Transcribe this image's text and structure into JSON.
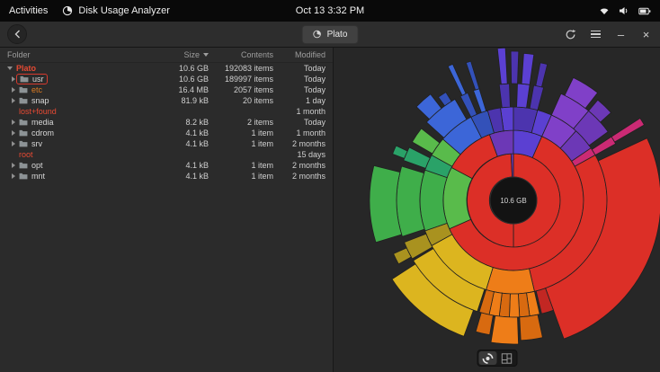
{
  "topbar": {
    "activities_label": "Activities",
    "app_menu_label": "Disk Usage Analyzer",
    "clock": "Oct 13  3:32 PM"
  },
  "headerbar": {
    "location_label": "Plato",
    "minimize_glyph": "–",
    "close_glyph": "×"
  },
  "table": {
    "columns": [
      "Folder",
      "Size",
      "Contents",
      "Modified"
    ],
    "rows": [
      {
        "name": "Plato",
        "size": "10.6 GB",
        "contents": "192083 items",
        "modified": "Today"
      },
      {
        "name": "usr",
        "size": "10.6 GB",
        "contents": "189997 items",
        "modified": "Today"
      },
      {
        "name": "etc",
        "size": "16.4 MB",
        "contents": "2057 items",
        "modified": "Today"
      },
      {
        "name": "snap",
        "size": "81.9 kB",
        "contents": "20 items",
        "modified": "1 day"
      },
      {
        "name": "lost+found",
        "size": "",
        "contents": "",
        "modified": "1 month"
      },
      {
        "name": "media",
        "size": "8.2 kB",
        "contents": "2 items",
        "modified": "Today"
      },
      {
        "name": "cdrom",
        "size": "4.1 kB",
        "contents": "1 item",
        "modified": "1 month"
      },
      {
        "name": "srv",
        "size": "4.1 kB",
        "contents": "1 item",
        "modified": "2 months"
      },
      {
        "name": "root",
        "size": "",
        "contents": "",
        "modified": "15 days"
      },
      {
        "name": "opt",
        "size": "4.1 kB",
        "contents": "1 item",
        "modified": "2 months"
      },
      {
        "name": "mnt",
        "size": "4.1 kB",
        "contents": "1 item",
        "modified": "2 months"
      }
    ]
  },
  "chart": {
    "center_label": "10.6 GB",
    "colors": {
      "red": "#dc2f27",
      "red2": "#c22723",
      "orange": "#ee7d18",
      "orange2": "#d86a10",
      "yellow": "#dcb51f",
      "olive": "#a9921f",
      "green": "#3fae4a",
      "green2": "#59bb4b",
      "teal": "#2aa268",
      "blue": "#3c66d8",
      "blue2": "#3351b9",
      "purple": "#8040c8",
      "purple2": "#6c38b6",
      "violet": "#5b40d2",
      "violet2": "#4c34ae",
      "magenta": "#cb2a74"
    },
    "segments": [
      [
        26,
        52,
        0,
        180,
        "red"
      ],
      [
        26,
        52,
        180,
        357,
        "red"
      ],
      [
        26,
        52,
        357,
        360,
        "purple2"
      ],
      [
        52,
        78,
        340,
        360,
        "purple2"
      ],
      [
        52,
        78,
        0,
        24,
        "violet"
      ],
      [
        52,
        78,
        24,
        246,
        "red"
      ],
      [
        52,
        78,
        246,
        298,
        "green2"
      ],
      [
        52,
        78,
        298,
        340,
        "red"
      ],
      [
        78,
        104,
        352,
        360,
        "violet"
      ],
      [
        78,
        104,
        0,
        15,
        "violet2"
      ],
      [
        78,
        104,
        15,
        24,
        "violet"
      ],
      [
        78,
        104,
        24,
        42,
        "purple"
      ],
      [
        78,
        104,
        42,
        56,
        "purple2"
      ],
      [
        78,
        104,
        56,
        61,
        "magenta"
      ],
      [
        78,
        104,
        61,
        167,
        "red"
      ],
      [
        78,
        104,
        167,
        197,
        "orange"
      ],
      [
        78,
        104,
        197,
        241,
        "yellow"
      ],
      [
        78,
        104,
        241,
        251,
        "olive"
      ],
      [
        78,
        104,
        251,
        289,
        "green"
      ],
      [
        78,
        104,
        289,
        299,
        "teal"
      ],
      [
        78,
        104,
        299,
        311,
        "green2"
      ],
      [
        78,
        104,
        311,
        333,
        "blue"
      ],
      [
        78,
        104,
        333,
        344,
        "blue2"
      ],
      [
        78,
        104,
        344,
        352,
        "violet2"
      ],
      [
        104,
        130,
        353,
        358,
        "violet2"
      ],
      [
        104,
        130,
        2,
        8,
        "violet"
      ],
      [
        104,
        130,
        10,
        15,
        "violet2"
      ],
      [
        104,
        130,
        24,
        40,
        "purple"
      ],
      [
        104,
        130,
        40,
        54,
        "purple2"
      ],
      [
        104,
        130,
        57,
        61,
        "magenta"
      ],
      [
        104,
        164,
        65,
        160,
        "red"
      ],
      [
        104,
        130,
        160,
        166,
        "red2"
      ],
      [
        104,
        130,
        167,
        172,
        "orange"
      ],
      [
        104,
        130,
        172,
        177,
        "orange2"
      ],
      [
        104,
        130,
        177,
        182,
        "orange"
      ],
      [
        104,
        130,
        182,
        187,
        "orange2"
      ],
      [
        104,
        130,
        187,
        192,
        "orange"
      ],
      [
        104,
        130,
        192,
        197,
        "orange2"
      ],
      [
        104,
        130,
        198,
        239,
        "yellow"
      ],
      [
        104,
        130,
        240,
        249,
        "olive"
      ],
      [
        104,
        130,
        252,
        287,
        "green"
      ],
      [
        104,
        130,
        290,
        297,
        "teal"
      ],
      [
        104,
        130,
        300,
        308,
        "green2"
      ],
      [
        104,
        130,
        312,
        330,
        "blue"
      ],
      [
        104,
        130,
        333,
        337,
        "blue2"
      ],
      [
        104,
        130,
        340,
        343,
        "blue"
      ],
      [
        130,
        170,
        354,
        357,
        "violet"
      ],
      [
        130,
        166,
        359,
        362,
        "violet2"
      ],
      [
        130,
        164,
        4,
        8,
        "violet"
      ],
      [
        130,
        156,
        11,
        14,
        "violet2"
      ],
      [
        130,
        152,
        26,
        38,
        "purple"
      ],
      [
        130,
        146,
        40,
        48,
        "purple2"
      ],
      [
        130,
        168,
        57,
        60,
        "magenta"
      ],
      [
        130,
        156,
        168,
        177,
        "orange2"
      ],
      [
        130,
        160,
        178,
        189,
        "orange"
      ],
      [
        130,
        152,
        190,
        196,
        "orange2"
      ],
      [
        130,
        161,
        200,
        237,
        "yellow"
      ],
      [
        130,
        146,
        241,
        246,
        "olive"
      ],
      [
        130,
        160,
        253,
        284,
        "green"
      ],
      [
        130,
        144,
        291,
        295,
        "teal"
      ],
      [
        130,
        150,
        314,
        322,
        "blue"
      ],
      [
        130,
        142,
        324,
        328,
        "blue2"
      ],
      [
        130,
        166,
        334,
        336,
        "blue"
      ],
      [
        130,
        162,
        341,
        343,
        "blue2"
      ]
    ]
  }
}
